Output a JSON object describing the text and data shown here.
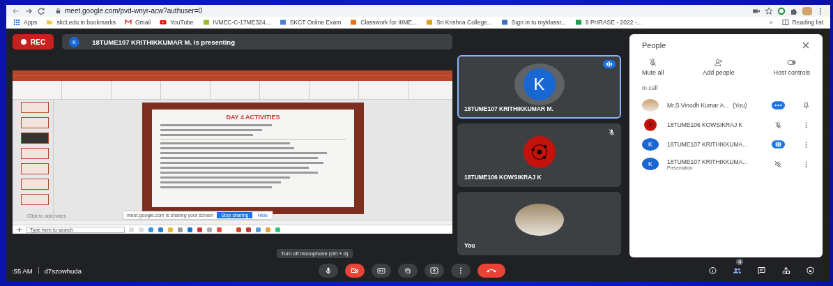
{
  "browser": {
    "url": "meet.google.com/pvd-wnyr-acw?authuser=0",
    "bookmarks": [
      {
        "kind": "apps",
        "label": "Apps"
      },
      {
        "kind": "folder",
        "label": "skct.edu.in bookmarks"
      },
      {
        "kind": "gmail",
        "label": "Gmail"
      },
      {
        "kind": "youtube",
        "label": "YouTube"
      },
      {
        "kind": "site",
        "color": "#9bbb2c",
        "label": "IVMEC-C-17ME324..."
      },
      {
        "kind": "site",
        "color": "#4a7fd0",
        "label": "SKCT Online Exam"
      },
      {
        "kind": "site",
        "color": "#e8711a",
        "label": "Classwork for IIIME..."
      },
      {
        "kind": "site",
        "color": "#d9a21b",
        "label": "Sri Krishna College..."
      },
      {
        "kind": "site",
        "color": "#3b6fc9",
        "label": "Sign in to myklassr..."
      },
      {
        "kind": "site",
        "color": "#1e9e4a",
        "label": "6 PHRASE - 2022 -..."
      }
    ],
    "more": "»",
    "reading_list": "Reading list"
  },
  "meeting": {
    "rec": "REC",
    "presenter": {
      "initial": "K",
      "text": "18TUME107 KRITHIKKUMAR M. is presenting"
    },
    "shared_screen": {
      "slide_title": "DAY 4 ACTIVITIES",
      "notes_placeholder": "Click to add notes",
      "share_notice": "meet.google.com is sharing your screen",
      "stop_button": "Stop sharing",
      "hide_button": "Hide",
      "taskbar_search": "Type here to search"
    },
    "tiles": [
      {
        "name": "18TUME107 KRITHIKKUMAR M.",
        "avatar": {
          "kind": "initial",
          "initial": "K"
        },
        "speaking": true,
        "muted": false
      },
      {
        "name": "18TUME106 KOWSIKRAJ K",
        "avatar": {
          "kind": "pattern"
        },
        "speaking": false,
        "muted": true
      },
      {
        "name": "You",
        "avatar": {
          "kind": "photo"
        },
        "speaking": false,
        "muted": false
      }
    ]
  },
  "people": {
    "title": "People",
    "actions": [
      {
        "kind": "mute",
        "label": "Mute all"
      },
      {
        "kind": "add",
        "label": "Add people"
      },
      {
        "kind": "host",
        "label": "Host controls"
      }
    ],
    "section": "In call",
    "participants": [
      {
        "name": "Mr.S.Vinodh Kumar A...",
        "suffix": "(You)",
        "avatar": {
          "kind": "photo"
        },
        "status": {
          "kind": "more"
        },
        "action": {
          "kind": "pin"
        }
      },
      {
        "name": "18TUME106 KOWSIKRAJ K",
        "avatar": {
          "kind": "pattern"
        },
        "status": {
          "kind": "muted"
        },
        "action": {
          "kind": "menu"
        }
      },
      {
        "name": "18TUME107 KRITHIKKUMA...",
        "avatar": {
          "kind": "initial",
          "initial": "K"
        },
        "status": {
          "kind": "speaking"
        },
        "action": {
          "kind": "menu"
        }
      },
      {
        "name": "18TUME107 KRITHIKKUMA...",
        "subtitle": "Presentation",
        "avatar": {
          "kind": "initial",
          "initial": "K"
        },
        "status": {
          "kind": "presenting"
        },
        "action": {
          "kind": "menu"
        }
      }
    ]
  },
  "controls": {
    "time": ":55 AM",
    "code": "d7szowhuda",
    "tooltip": "Turn off microphone (ctrl + d)",
    "buttons": [
      {
        "kind": "mic",
        "on": true
      },
      {
        "kind": "camera",
        "on": false
      },
      {
        "kind": "captions"
      },
      {
        "kind": "hand"
      },
      {
        "kind": "present"
      },
      {
        "kind": "more"
      },
      {
        "kind": "leave"
      }
    ],
    "side": [
      {
        "kind": "info"
      },
      {
        "kind": "people",
        "badge": "4"
      },
      {
        "kind": "chat"
      },
      {
        "kind": "activities"
      },
      {
        "kind": "lock"
      }
    ]
  }
}
